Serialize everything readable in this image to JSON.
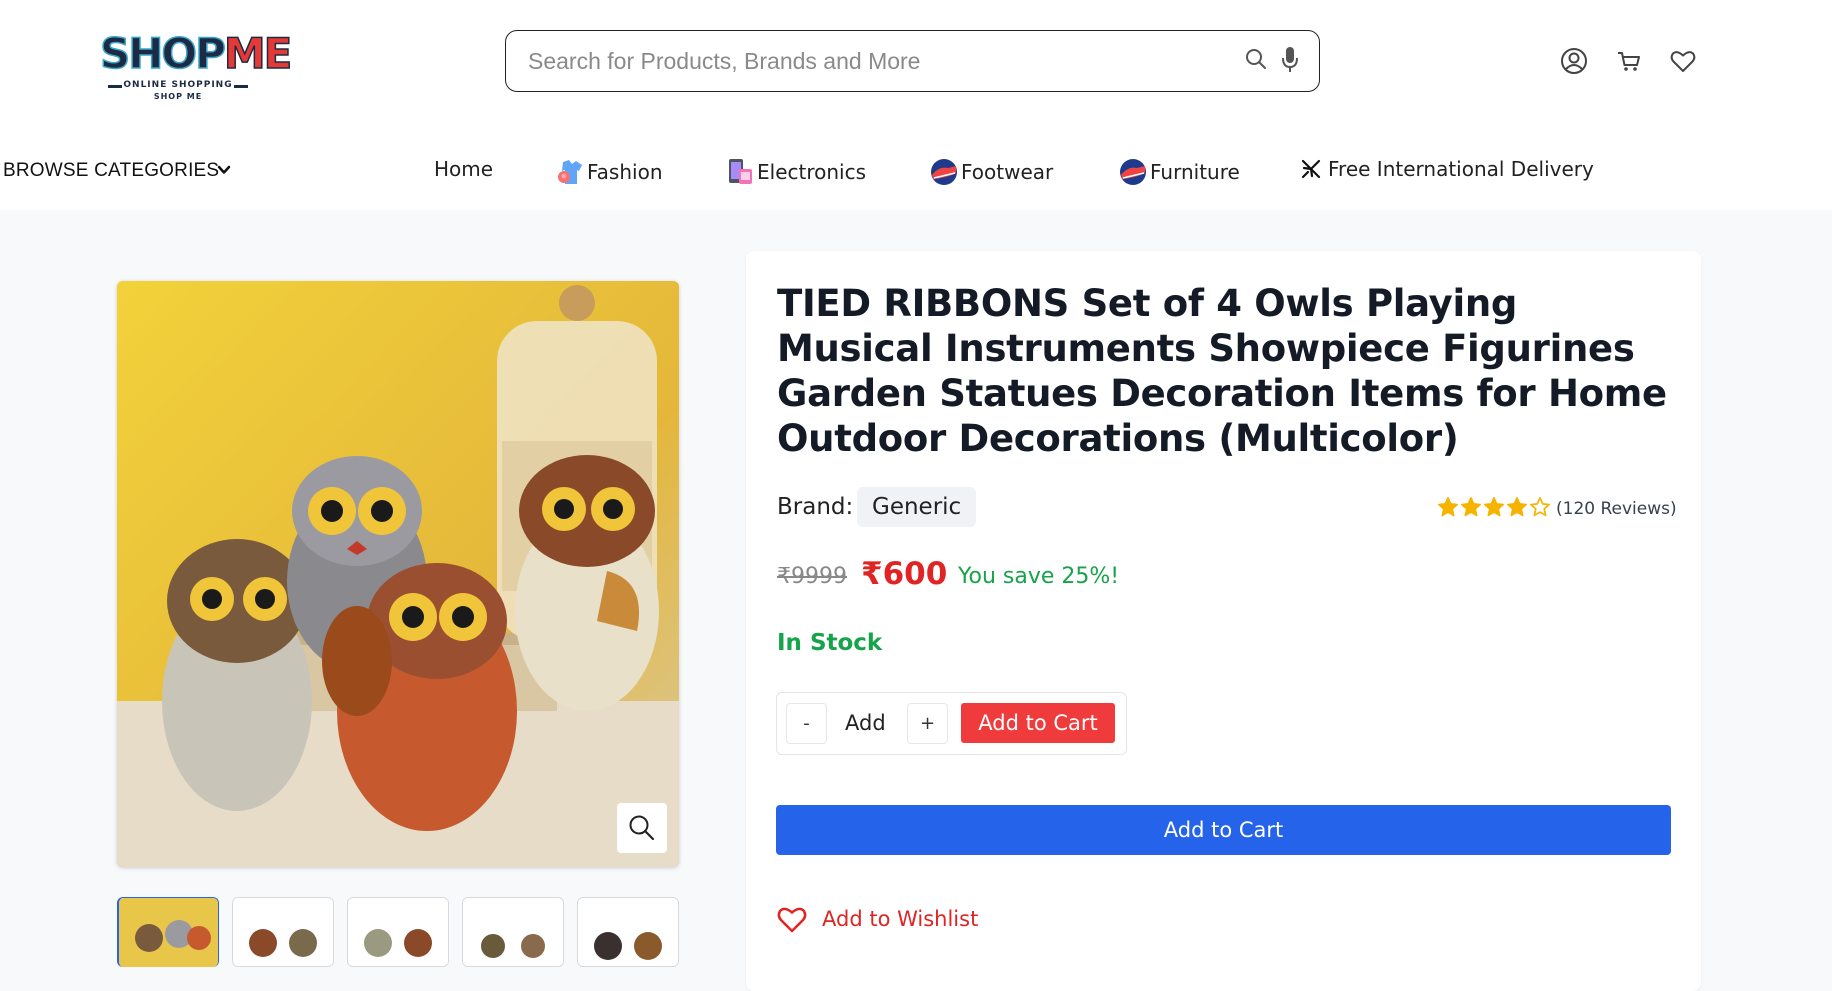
{
  "header": {
    "logo": {
      "main_left": "SHOP",
      "main_right": "ME",
      "tagline": "ONLINE SHOPPING",
      "subtag": "SHOP ME"
    },
    "search": {
      "placeholder": "Search for Products, Brands and More",
      "value": ""
    }
  },
  "nav": {
    "browse_label": "BROWSE CATEGORIES",
    "items": [
      {
        "label": "Home"
      },
      {
        "label": "Fashion"
      },
      {
        "label": "Electronics"
      },
      {
        "label": "Footwear"
      },
      {
        "label": "Furniture"
      },
      {
        "label": "Free International Delivery"
      }
    ]
  },
  "product": {
    "title": "TIED RIBBONS Set of 4 Owls Playing Musical Instruments Showpiece Figurines Garden Statues Decoration Items for Home Outdoor Decorations (Multicolor)",
    "brand_label": "Brand:",
    "brand": "Generic",
    "rating": 4,
    "rating_max": 5,
    "reviews": "(120 Reviews)",
    "old_price": "₹9999",
    "price": "₹600",
    "save_text": "You save 25%!",
    "stock": "In Stock",
    "qty_minus": "-",
    "qty_value": "Add",
    "qty_plus": "+",
    "add_to_cart_small": "Add to Cart",
    "add_to_cart": "Add to Cart",
    "wishlist": "Add to Wishlist"
  },
  "colors": {
    "accent_blue": "#2563eb",
    "price_red": "#e02424",
    "stock_green": "#16a34a",
    "star_gold": "#f5b400"
  }
}
